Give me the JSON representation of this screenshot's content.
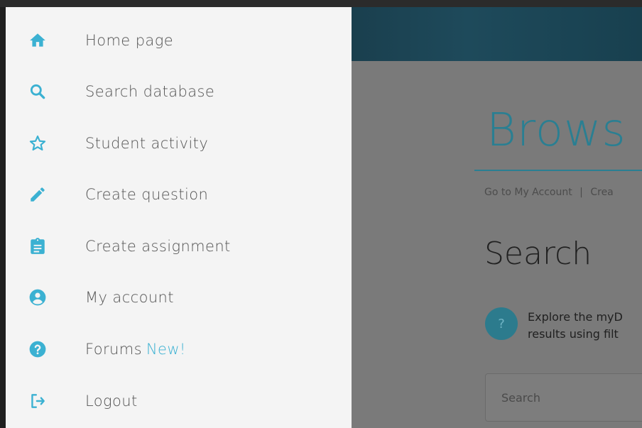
{
  "colors": {
    "accent": "#3bb1d2",
    "drawer_bg": "#f4f4f4",
    "label": "#555555",
    "overlay_page": "#7a7a7a",
    "title_teal": "#2a7f92"
  },
  "drawer": {
    "items": [
      {
        "label": "Home page",
        "icon": "home-icon"
      },
      {
        "label": "Search database",
        "icon": "search-icon"
      },
      {
        "label": "Student activity",
        "icon": "star-icon"
      },
      {
        "label": "Create question",
        "icon": "pencil-icon"
      },
      {
        "label": "Create assignment",
        "icon": "clipboard-icon"
      },
      {
        "label": "My account",
        "icon": "account-icon"
      },
      {
        "label": "Forums",
        "badge": "New!",
        "icon": "help-icon"
      },
      {
        "label": "Logout",
        "icon": "logout-icon"
      }
    ]
  },
  "background_page": {
    "title": "Brows",
    "links": [
      "Go to My Account",
      "Crea"
    ],
    "search_heading": "Search",
    "help_line1": "Explore the myD",
    "help_line2": "results using filt",
    "search_placeholder": "Search",
    "help_icon_glyph": "?"
  }
}
